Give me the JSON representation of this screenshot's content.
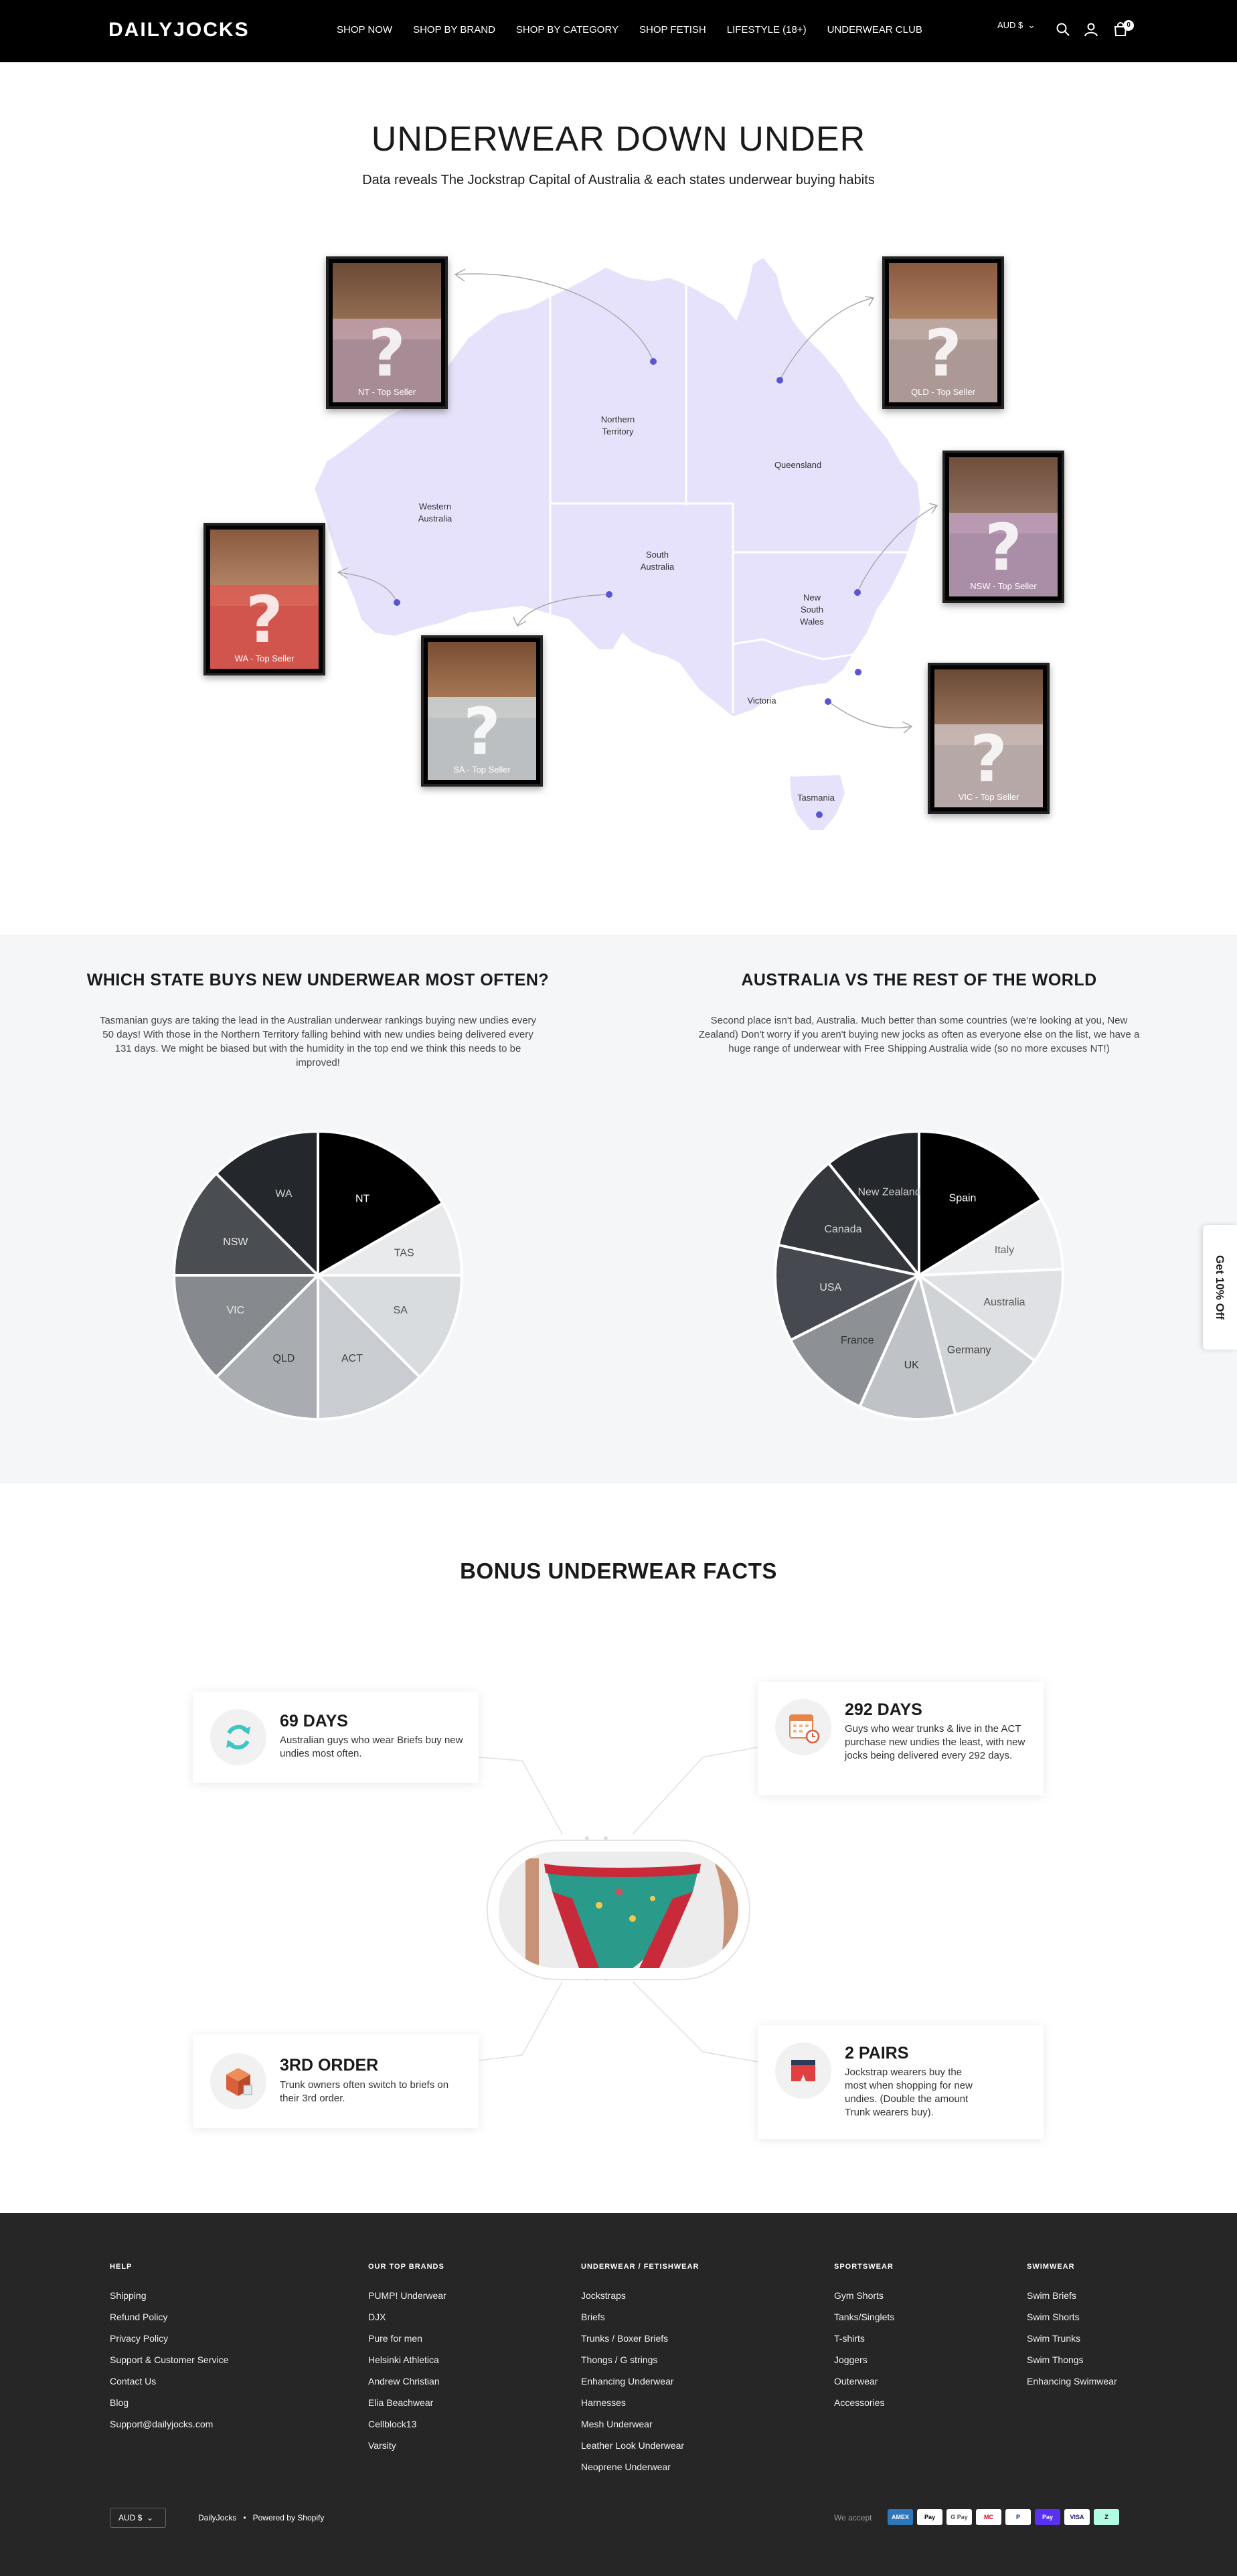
{
  "header": {
    "logo": "DAILYJOCKS",
    "nav": [
      "SHOP NOW",
      "SHOP BY BRAND",
      "SHOP BY CATEGORY",
      "SHOP FETISH",
      "LIFESTYLE (18+)",
      "UNDERWEAR CLUB"
    ],
    "currency": "AUD $",
    "cart_count": "0"
  },
  "hero": {
    "title": "UNDERWEAR DOWN UNDER",
    "subtitle": "Data reveals The Jockstrap Capital of Australia & each states underwear buying habits"
  },
  "map": {
    "states": [
      {
        "name": "Western\nAustralia"
      },
      {
        "name": "Northern\nTerritory"
      },
      {
        "name": "South\nAustralia"
      },
      {
        "name": "Queensland"
      },
      {
        "name": "New\nSouth\nWales"
      },
      {
        "name": "Victoria"
      },
      {
        "name": "Tasmania"
      }
    ],
    "cards": [
      {
        "caption": "NT - Top Seller"
      },
      {
        "caption": "QLD - Top Seller"
      },
      {
        "caption": "NSW - Top Seller"
      },
      {
        "caption": "WA - Top Seller"
      },
      {
        "caption": "SA - Top Seller"
      },
      {
        "caption": "VIC - Top Seller"
      }
    ]
  },
  "stats": {
    "left": {
      "title": "WHICH STATE BUYS NEW UNDERWEAR MOST OFTEN?",
      "text": "Tasmanian guys are taking the lead in the Australian underwear rankings buying new undies every 50 days! With those in the Northern Territory falling behind with new undies being delivered every 131 days. We might be biased but with the humidity in the top end we think this needs to be improved!"
    },
    "right": {
      "title": "AUSTRALIA VS THE REST OF THE WORLD",
      "text": "Second place isn't bad, Australia. Much better than some countries (we're looking at you, New Zealand) Don't worry if you aren't buying new jocks as often as everyone else on the list, we have a huge range of underwear with Free Shipping Australia wide (so no more excuses NT!)"
    },
    "tab_label": "Get 10% Off"
  },
  "chart_data": [
    {
      "type": "pie",
      "categories": [
        "NT",
        "TAS",
        "SA",
        "ACT",
        "QLD",
        "VIC",
        "NSW",
        "WA"
      ],
      "values": [
        1,
        0.5,
        0.75,
        0.75,
        0.75,
        0.75,
        0.75,
        0.75
      ],
      "colors": [
        "#000000",
        "#e8eaec",
        "#d9dcdf",
        "#c9ccd0",
        "#a9acb0",
        "#86898d",
        "#4a4d52",
        "#24272b"
      ],
      "label_colors": [
        "#ffffff",
        "#555555",
        "#555555",
        "#444444",
        "#333333",
        "#e8e8e8",
        "#e8e8e8",
        "#cccccc"
      ]
    },
    {
      "type": "pie",
      "categories": [
        "Spain",
        "Italy",
        "Australia",
        "Germany",
        "UK",
        "France",
        "USA",
        "Canada",
        "New Zealand"
      ],
      "values": [
        1,
        0.5,
        0.6667,
        0.6667,
        0.6667,
        0.6667,
        0.6667,
        0.6667,
        0.6667
      ],
      "colors": [
        "#000000",
        "#eceef0",
        "#dfe1e4",
        "#d0d3d6",
        "#bfc2c6",
        "#8d9095",
        "#464950",
        "#35383d",
        "#24272b"
      ],
      "label_colors": [
        "#ffffff",
        "#666666",
        "#555555",
        "#444444",
        "#333333",
        "#333333",
        "#e0e0e0",
        "#d0d0d0",
        "#cccccc"
      ]
    }
  ],
  "bonus": {
    "title": "BONUS UNDERWEAR FACTS",
    "facts": [
      {
        "head": "69 DAYS",
        "body": "Australian guys who wear Briefs buy new undies most often.",
        "icon": "refresh-icon"
      },
      {
        "head": "292 DAYS",
        "body": "Guys who wear trunks & live in the ACT purchase new undies the least, with new jocks being delivered every 292 days.",
        "icon": "calendar-icon"
      },
      {
        "head": "3RD ORDER",
        "body": "Trunk owners often switch to briefs on their 3rd order.",
        "icon": "box-icon"
      },
      {
        "head": "2 PAIRS",
        "body": "Jockstrap wearers buy the most when shopping for new undies. (Double the amount Trunk wearers buy).",
        "icon": "trunk-icon"
      }
    ]
  },
  "footer": {
    "columns": [
      {
        "head": "HELP",
        "links": [
          "Shipping",
          "Refund Policy",
          "Privacy Policy",
          "Support & Customer Service",
          "Contact Us",
          "Blog",
          "Support@dailyjocks.com"
        ]
      },
      {
        "head": "OUR TOP BRANDS",
        "links": [
          "PUMP! Underwear",
          "DJX",
          "Pure for men",
          "Helsinki Athletica",
          "Andrew Christian",
          "Elia Beachwear",
          "Cellblock13",
          "Varsity"
        ]
      },
      {
        "head": "UNDERWEAR / FETISHWEAR",
        "links": [
          "Jockstraps",
          "Briefs",
          "Trunks / Boxer Briefs",
          "Thongs / G strings",
          "Enhancing Underwear",
          "Harnesses",
          "Mesh Underwear",
          "Leather Look Underwear",
          "Neoprene Underwear"
        ]
      },
      {
        "head": "SPORTSWEAR",
        "links": [
          "Gym Shorts",
          "Tanks/Singlets",
          "T-shirts",
          "Joggers",
          "Outerwear",
          "Accessories"
        ]
      },
      {
        "head": "SWIMWEAR",
        "links": [
          "Swim Briefs",
          "Swim Shorts",
          "Swim Trunks",
          "Swim Thongs",
          "Enhancing Swimwear"
        ]
      }
    ],
    "currency": "AUD $",
    "copyright": "DailyJocks",
    "powered": "Powered by Shopify",
    "we_accept": "We accept",
    "payments": [
      "AMEX",
      "Pay",
      "G Pay",
      "MC",
      "P",
      "Pay",
      "VISA",
      "Z"
    ]
  }
}
